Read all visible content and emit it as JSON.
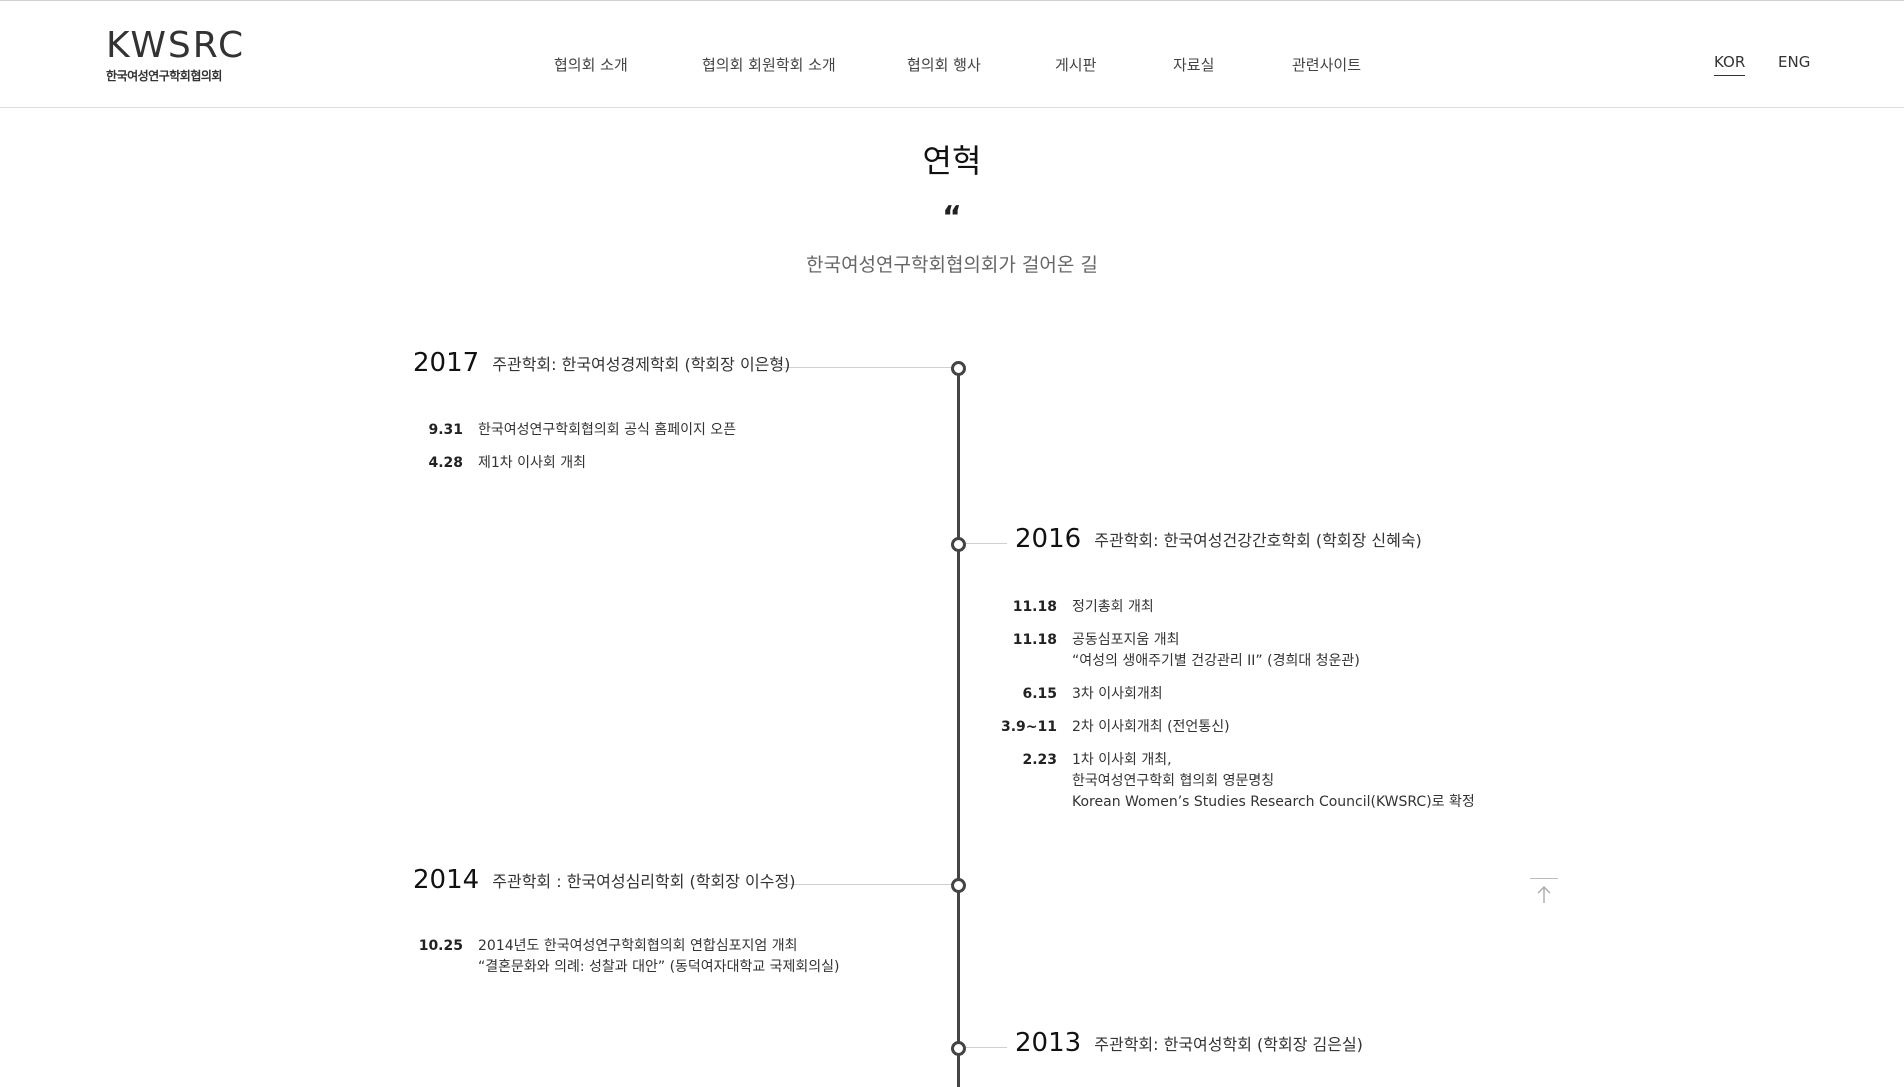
{
  "header": {
    "logo_text": "KWSRC",
    "logo_sub": "한국여성연구학회협의회",
    "nav": [
      {
        "label": "협의회 소개"
      },
      {
        "label": "협의회 회원학회 소개"
      },
      {
        "label": "협의회 행사"
      },
      {
        "label": "게시판"
      },
      {
        "label": "자료실"
      },
      {
        "label": "관련사이트"
      }
    ],
    "lang": {
      "kor": "KOR",
      "eng": "ENG",
      "active": "KOR"
    }
  },
  "page": {
    "title": "연혁",
    "quote_mark": "“",
    "subtitle": "한국여성연구학회협의회가 걸어온 길"
  },
  "timeline": [
    {
      "year": "2017",
      "host": "주관학회: 한국여성경제학회 (학회장 이은형)",
      "side": "left",
      "events": [
        {
          "date": "9.31",
          "lines": [
            "한국여성연구학회협의회 공식 홈페이지 오픈"
          ]
        },
        {
          "date": "4.28",
          "lines": [
            "제1차 이사회 개최"
          ]
        }
      ]
    },
    {
      "year": "2016",
      "host": "주관학회: 한국여성건강간호학회 (학회장 신혜숙)",
      "side": "right",
      "events": [
        {
          "date": "11.18",
          "lines": [
            "정기총회 개최"
          ]
        },
        {
          "date": "11.18",
          "lines": [
            "공동심포지움 개최",
            "“여성의 생애주기별 건강관리 II” (경희대 청운관)"
          ]
        },
        {
          "date": "6.15",
          "lines": [
            "3차 이사회개최"
          ]
        },
        {
          "date": "3.9~11",
          "lines": [
            "2차 이사회개최 (전언통신)"
          ]
        },
        {
          "date": "2.23",
          "lines": [
            "1차 이사회 개최,",
            "한국여성연구학회 협의회 영문명칭",
            "Korean Women’s Studies Research Council(KWSRC)로 확정"
          ]
        }
      ]
    },
    {
      "year": "2014",
      "host": "주관학회 : 한국여성심리학회 (학회장 이수정)",
      "side": "left",
      "events": [
        {
          "date": "10.25",
          "lines": [
            "2014년도 한국여성연구학회협의회 연합심포지엄 개최",
            "“결혼문화와 의례: 성찰과 대안” (동덕여자대학교 국제회의실)"
          ]
        }
      ]
    },
    {
      "year": "2013",
      "host": "주관학회: 한국여성학회 (학회장 김은실)",
      "side": "right",
      "events": []
    }
  ],
  "icons": {
    "to_top": "arrow-up-icon"
  },
  "colors": {
    "timeline": "#444444",
    "connector": "#cfcfcf",
    "text": "#222222"
  }
}
